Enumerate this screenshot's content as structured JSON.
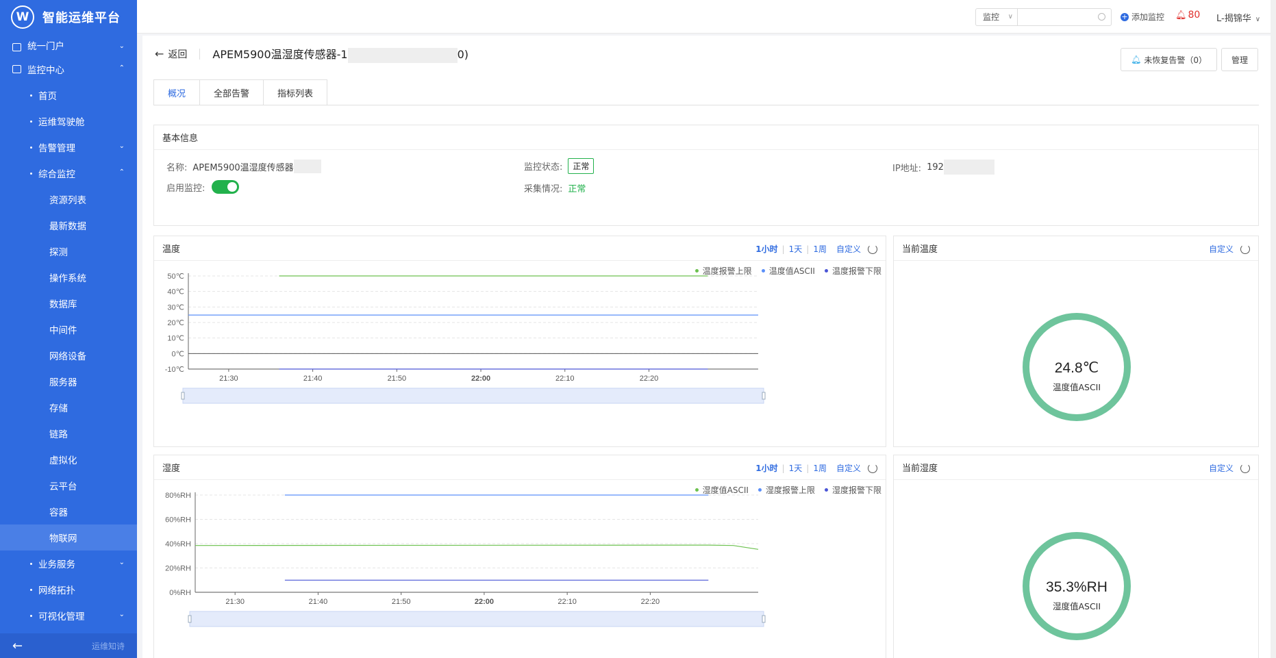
{
  "app": {
    "logo_mark": "W",
    "title": "智能运维平台"
  },
  "sidebar": {
    "items": [
      {
        "label": "统一门户",
        "level": 1,
        "caret": "⌄"
      },
      {
        "label": "监控中心",
        "level": 1,
        "caret": "⌃"
      },
      {
        "label": "首页",
        "level": 2
      },
      {
        "label": "运维驾驶舱",
        "level": 2
      },
      {
        "label": "告警管理",
        "level": 2,
        "caret": "⌄"
      },
      {
        "label": "综合监控",
        "level": 2,
        "caret": "⌃"
      },
      {
        "label": "资源列表",
        "level": 3
      },
      {
        "label": "最新数据",
        "level": 3
      },
      {
        "label": "探测",
        "level": 3
      },
      {
        "label": "操作系统",
        "level": 3
      },
      {
        "label": "数据库",
        "level": 3
      },
      {
        "label": "中间件",
        "level": 3
      },
      {
        "label": "网络设备",
        "level": 3
      },
      {
        "label": "服务器",
        "level": 3
      },
      {
        "label": "存储",
        "level": 3
      },
      {
        "label": "链路",
        "level": 3
      },
      {
        "label": "虚拟化",
        "level": 3
      },
      {
        "label": "云平台",
        "level": 3
      },
      {
        "label": "容器",
        "level": 3
      },
      {
        "label": "物联网",
        "level": 3,
        "active": true
      },
      {
        "label": "业务服务",
        "level": 2,
        "caret": "⌄"
      },
      {
        "label": "网络拓扑",
        "level": 2
      },
      {
        "label": "可视化管理",
        "level": 2,
        "caret": "⌄"
      }
    ],
    "footer_slogan": "运维知诗"
  },
  "topbar": {
    "select_value": "监控",
    "search_placeholder": "",
    "add_label": "添加监控",
    "alert_count": "80",
    "user": "L-揭锦华"
  },
  "page": {
    "back_label": "返回",
    "title": "APEM5900温湿度传感器-1",
    "title_suffix": "0)",
    "unrecovered_label": "未恢复告警",
    "unrecovered_count": "（0）",
    "manage_label": "管理"
  },
  "tabs": [
    "概况",
    "全部告警",
    "指标列表"
  ],
  "basic_info": {
    "header": "基本信息",
    "name_label": "名称:",
    "name_value": "APEM5900温湿度传感器",
    "status_label": "监控状态:",
    "status_value": "正常",
    "ip_label": "IP地址:",
    "ip_value": "192",
    "enable_label": "启用监控:",
    "enabled": true,
    "collect_label": "采集情况:",
    "collect_value": "正常"
  },
  "ranges": [
    "1小时",
    "1天",
    "1周"
  ],
  "custom_label": "自定义",
  "colors": {
    "green": "#6cc14f",
    "blue": "#5b8ff9",
    "navy": "#4a55d6",
    "gauge": "#6ec49c",
    "accent": "#2f6be0"
  },
  "temp_chart": {
    "title": "温度",
    "legend": [
      "温度报警上限",
      "温度值ASCII",
      "温度报警下限"
    ],
    "y_ticks": [
      "50℃",
      "40℃",
      "30℃",
      "20℃",
      "10℃",
      "0℃",
      "-10℃"
    ],
    "x_ticks": [
      "21:30",
      "21:40",
      "21:50",
      "22:00",
      "22:10",
      "22:20"
    ]
  },
  "hum_chart": {
    "title": "湿度",
    "legend": [
      "湿度值ASCII",
      "湿度报警上限",
      "湿度报警下限"
    ],
    "y_ticks": [
      "80%RH",
      "60%RH",
      "40%RH",
      "20%RH",
      "0%RH"
    ],
    "x_ticks": [
      "21:30",
      "21:40",
      "21:50",
      "22:00",
      "22:10",
      "22:20"
    ]
  },
  "chart_data": [
    {
      "type": "line",
      "title": "温度",
      "ylim": [
        -10,
        50
      ],
      "x_ticks": [
        "21:30",
        "21:40",
        "21:50",
        "22:00",
        "22:10",
        "22:20"
      ],
      "series": [
        {
          "name": "温度报警上限",
          "color": "#6cc14f",
          "x": [
            21.6,
            22.45
          ],
          "values": [
            50,
            50
          ]
        },
        {
          "name": "温度值ASCII",
          "color": "#5b8ff9",
          "x": [
            21.42,
            22.55
          ],
          "values": [
            24.8,
            24.8
          ]
        },
        {
          "name": "温度报警下限",
          "color": "#4a55d6",
          "x": [
            21.6,
            22.45
          ],
          "values": [
            -10,
            -10
          ]
        }
      ]
    },
    {
      "type": "line",
      "title": "湿度",
      "ylim": [
        0,
        80
      ],
      "x_ticks": [
        "21:30",
        "21:40",
        "21:50",
        "22:00",
        "22:10",
        "22:20"
      ],
      "series": [
        {
          "name": "湿度值ASCII",
          "color": "#6cc14f",
          "x": [
            21.42,
            22.45,
            22.5,
            22.55
          ],
          "values": [
            38.5,
            38.8,
            38.5,
            35.3
          ]
        },
        {
          "name": "湿度报警上限",
          "color": "#5b8ff9",
          "x": [
            21.6,
            22.45
          ],
          "values": [
            80,
            80
          ]
        },
        {
          "name": "湿度报警下限",
          "color": "#4a55d6",
          "x": [
            21.6,
            22.45
          ],
          "values": [
            10,
            10
          ]
        }
      ]
    }
  ],
  "gauges": [
    {
      "title": "当前温度",
      "value": "24.8℃",
      "label": "温度值ASCII"
    },
    {
      "title": "当前湿度",
      "value": "35.3%RH",
      "label": "湿度值ASCII"
    }
  ]
}
